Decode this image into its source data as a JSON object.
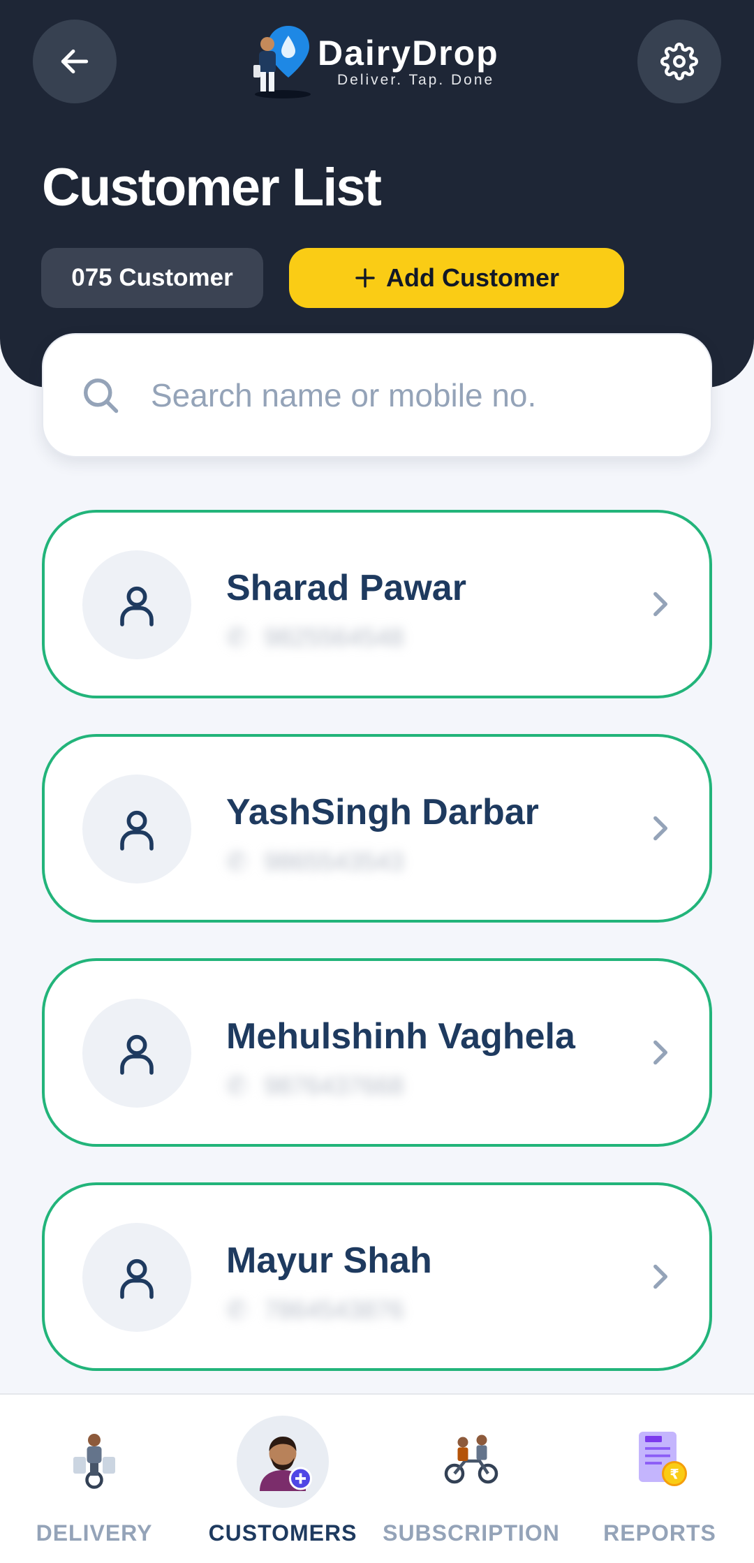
{
  "app": {
    "name": "DairyDrop",
    "tagline": "Deliver. Tap. Done"
  },
  "header": {
    "title": "Customer List",
    "count_label": "075 Customer",
    "add_button_label": "Add Customer"
  },
  "search": {
    "placeholder": "Search name or mobile no."
  },
  "customers": [
    {
      "name": "Sharad Pawar",
      "phone": "9825564548"
    },
    {
      "name": "YashSingh Darbar",
      "phone": "9865543543"
    },
    {
      "name": "Mehulshinh Vaghela",
      "phone": "9876437668"
    },
    {
      "name": "Mayur Shah",
      "phone": "7864543876"
    }
  ],
  "bottom_nav": [
    {
      "label": "DELIVERY",
      "icon": "delivery-rider-icon",
      "active": false
    },
    {
      "label": "CUSTOMERS",
      "icon": "customer-add-icon",
      "active": true
    },
    {
      "label": "SUBSCRIPTION",
      "icon": "subscription-bike-icon",
      "active": false
    },
    {
      "label": "REPORTS",
      "icon": "bill-report-icon",
      "active": false
    }
  ],
  "colors": {
    "header_bg": "#1e2636",
    "accent_yellow": "#facc15",
    "card_border": "#22b47a",
    "text_primary": "#1e3a5f",
    "text_muted": "#94a3b8"
  }
}
